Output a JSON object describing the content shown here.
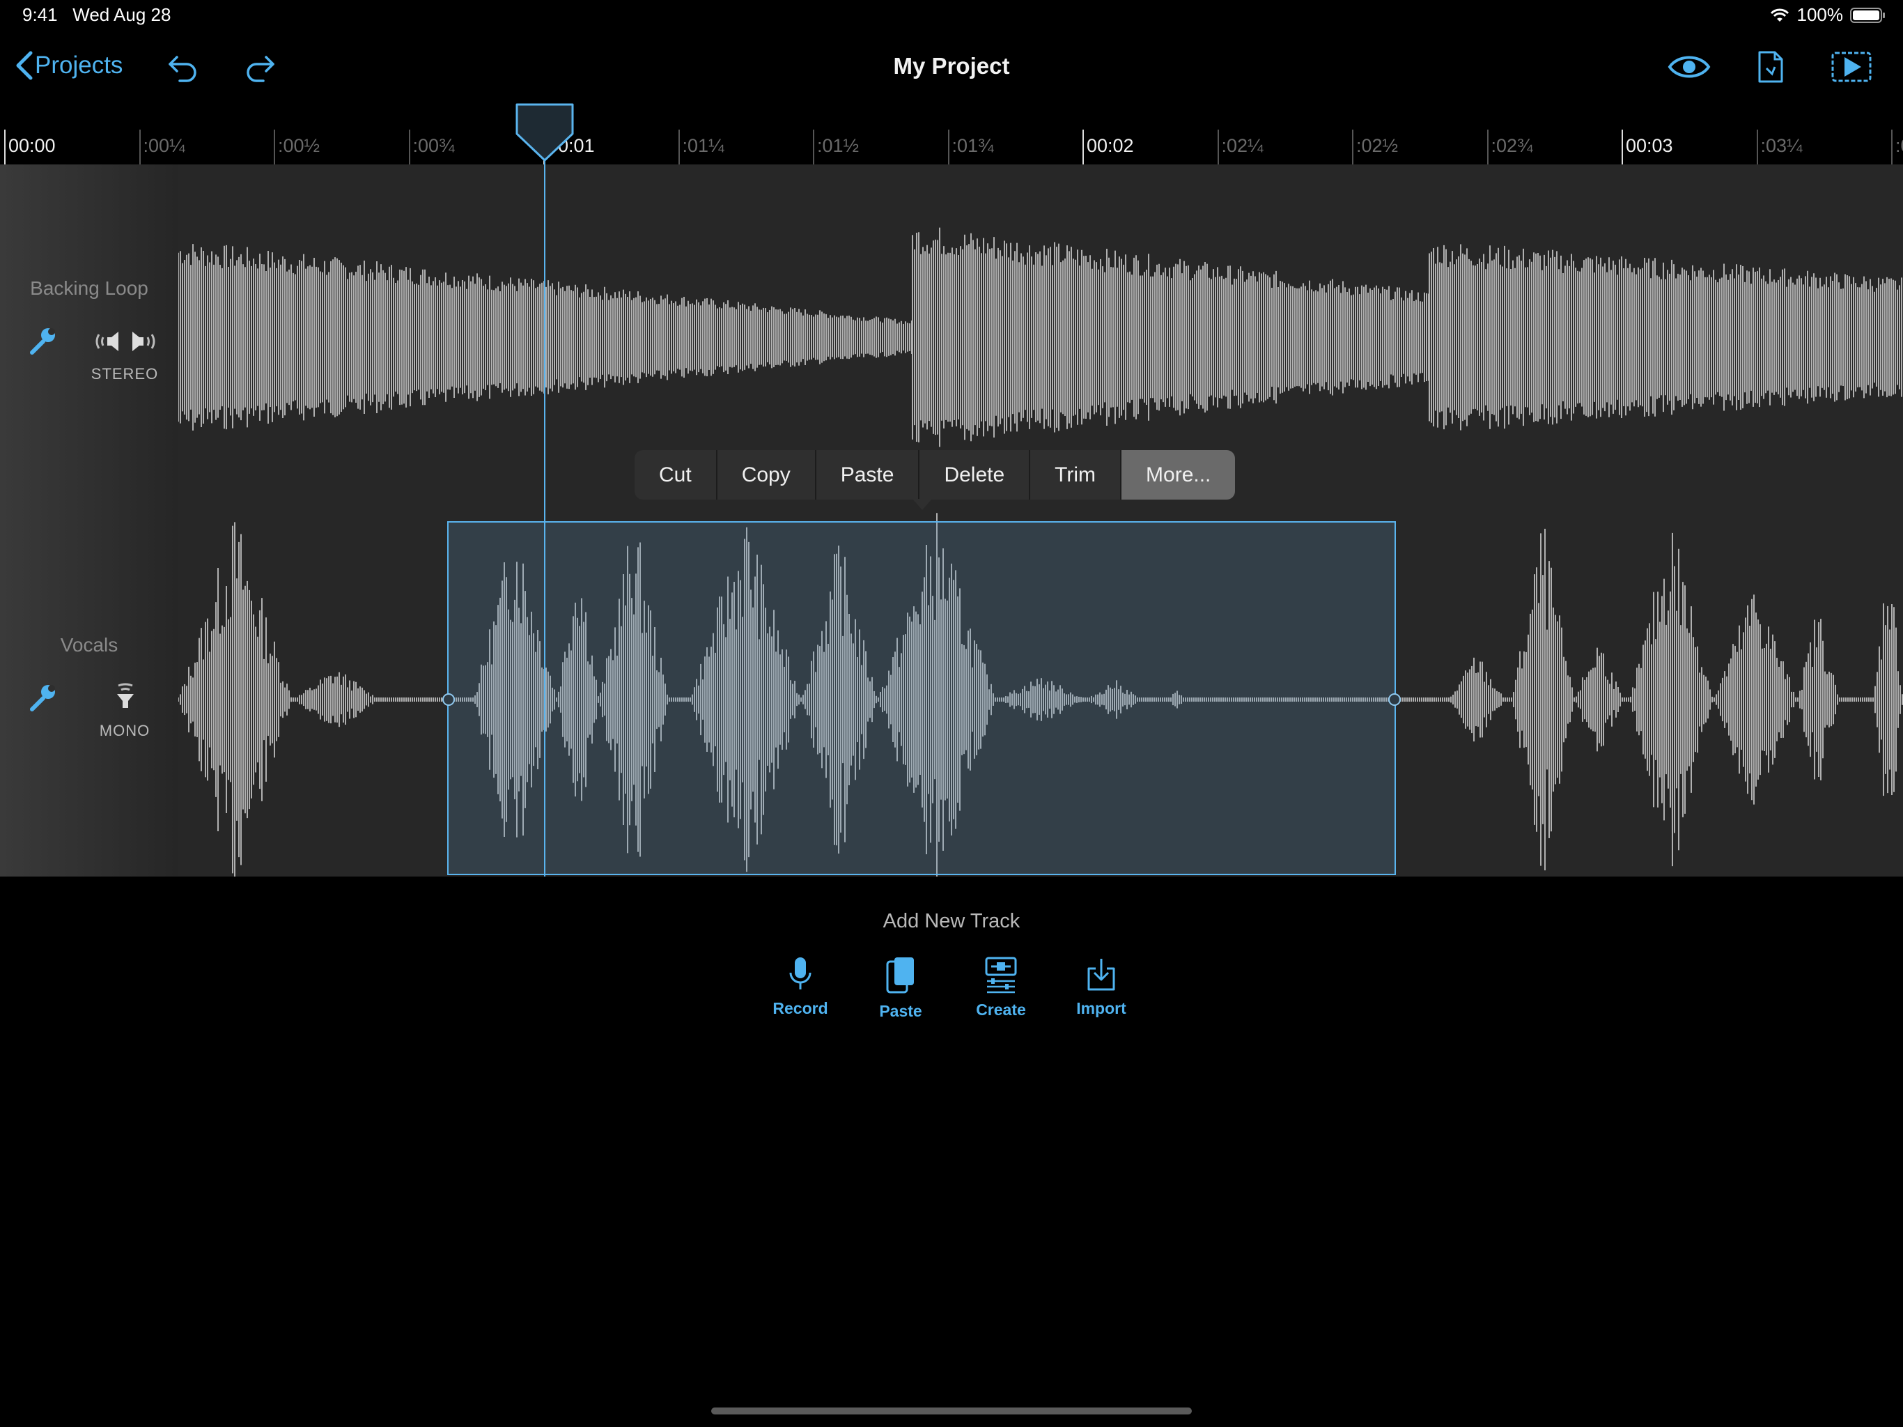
{
  "status": {
    "time": "9:41",
    "date": "Wed Aug 28",
    "battery": "100%"
  },
  "nav": {
    "back_label": "Projects",
    "title": "My Project"
  },
  "ruler": {
    "ticks": [
      "00:00",
      ":00¼",
      ":00½",
      ":00¾",
      "00:01",
      ":01¼",
      ":01½",
      ":01¾",
      "00:02",
      ":02¼",
      ":02½",
      ":02¾",
      "00:03",
      ":03¼",
      ":0"
    ]
  },
  "tracks": [
    {
      "name": "Backing Loop",
      "mode": "STEREO"
    },
    {
      "name": "Vocals",
      "mode": "MONO"
    }
  ],
  "context_menu": {
    "items": [
      "Cut",
      "Copy",
      "Paste",
      "Delete",
      "Trim",
      "More..."
    ]
  },
  "add_track": {
    "title": "Add New Track",
    "buttons": [
      "Record",
      "Paste",
      "Create",
      "Import"
    ]
  },
  "colors": {
    "accent": "#4fb3f0",
    "waveform": "#b0b0b0",
    "selection": "#5ab4ee"
  }
}
